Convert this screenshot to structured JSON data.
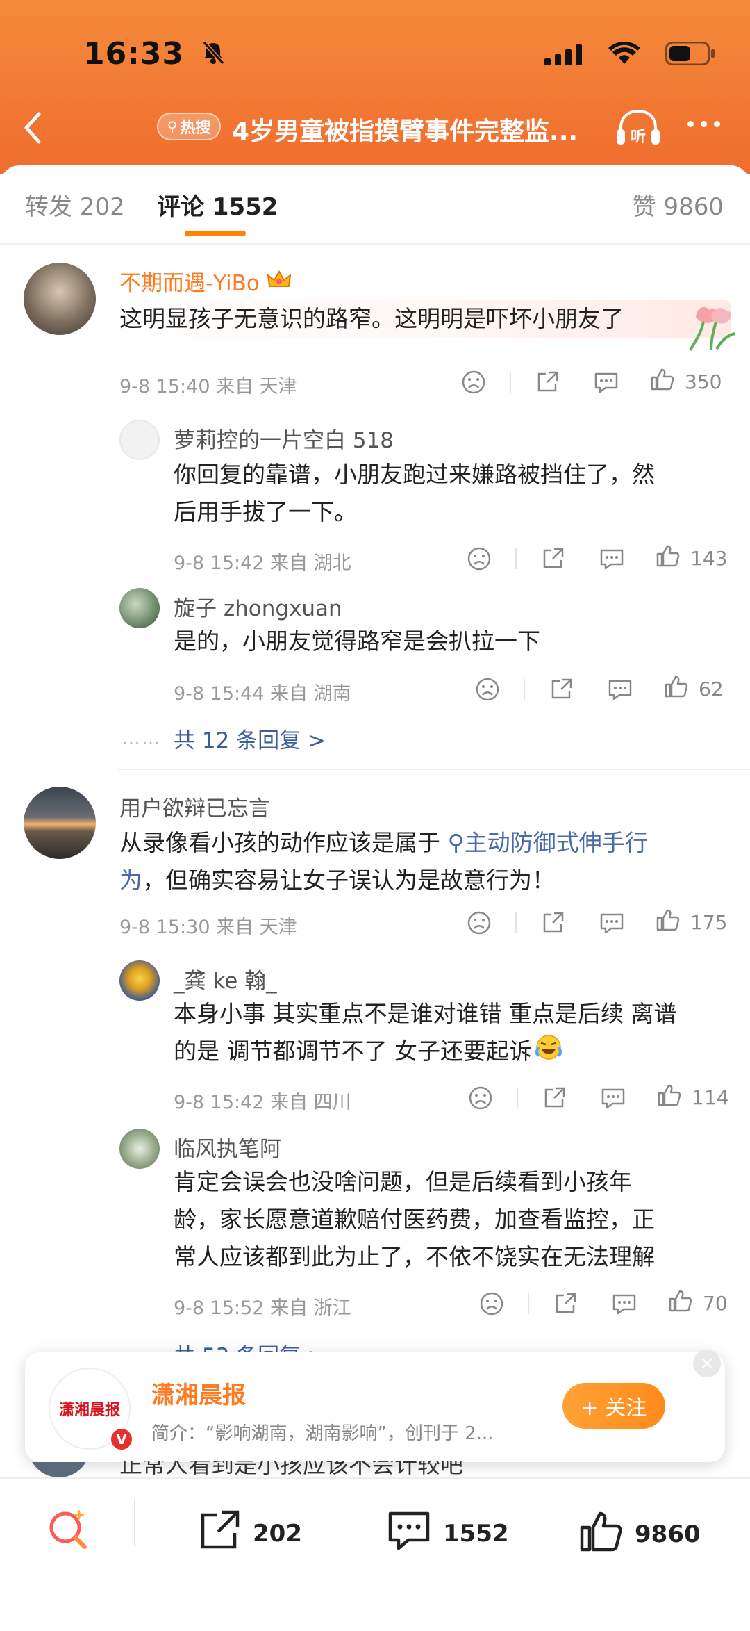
{
  "status": {
    "time": "16:33"
  },
  "nav": {
    "hot_badge": "热搜",
    "title": "4岁男童被指摸臂事件完整监...",
    "listen_label": "听"
  },
  "tabs": {
    "repost": "转发 202",
    "comments": "评论 1552",
    "likes": "赞 9860"
  },
  "comments": [
    {
      "user": "不期而遇-YiBo",
      "text": "这明显孩子无意识的路窄。这明明是吓坏小朋友了",
      "meta": "9-8 15:40  来自 天津",
      "likes": "350",
      "replies": [
        {
          "user": "萝莉控的一片空白 518",
          "text_lines": [
            "你回复的靠谱，小朋友跑过来嫌路被挡住了，然",
            "后用手拔了一下。"
          ],
          "meta": "9-8 15:42  来自 湖北",
          "likes": "143"
        },
        {
          "user": "旋子 zhongxuan",
          "text_lines": [
            "是的，小朋友觉得路窄是会扒拉一下"
          ],
          "meta": "9-8 15:44  来自 湖南",
          "likes": "62"
        }
      ],
      "more_replies": "共 12 条回复 >"
    },
    {
      "user": "用户欲辩已忘言",
      "text_before": "从录像看小孩的动作应该是属于 ",
      "text_link": "主动防御式伸手行",
      "text_link2": "为",
      "text_after": "，但确实容易让女子误认为是故意行为！",
      "meta": "9-8 15:30  来自 天津",
      "likes": "175",
      "replies": [
        {
          "user": "_龚 ke 翰_",
          "text_lines": [
            "本身小事 其实重点不是谁对谁错 重点是后续 离谱",
            "的是 调节都调节不了 女子还要起诉"
          ],
          "meta": "9-8 15:42  来自 四川",
          "likes": "114"
        },
        {
          "user": "临风执笔阿",
          "text_lines": [
            "肯定会误会也没啥问题，但是后续看到小孩年",
            "龄，家长愿意道歉赔付医药费，加查看监控，正",
            "常人应该都到此为止了，不依不饶实在无法理解"
          ],
          "meta": "9-8 15:52  来自 浙江",
          "likes": "70"
        }
      ],
      "more_replies": "共 53 条回复 >"
    }
  ],
  "banner": {
    "logo_text": "潇湘晨报",
    "name": "潇湘晨报",
    "desc": "简介：“影响湖南，湖南影响”，创刊于 2...",
    "follow": "+ 关注",
    "close": "×"
  },
  "partial_comment": "正常人看到是小孩应该不会计较吧",
  "bottom": {
    "repost": "202",
    "comments": "1552",
    "likes": "9860"
  }
}
